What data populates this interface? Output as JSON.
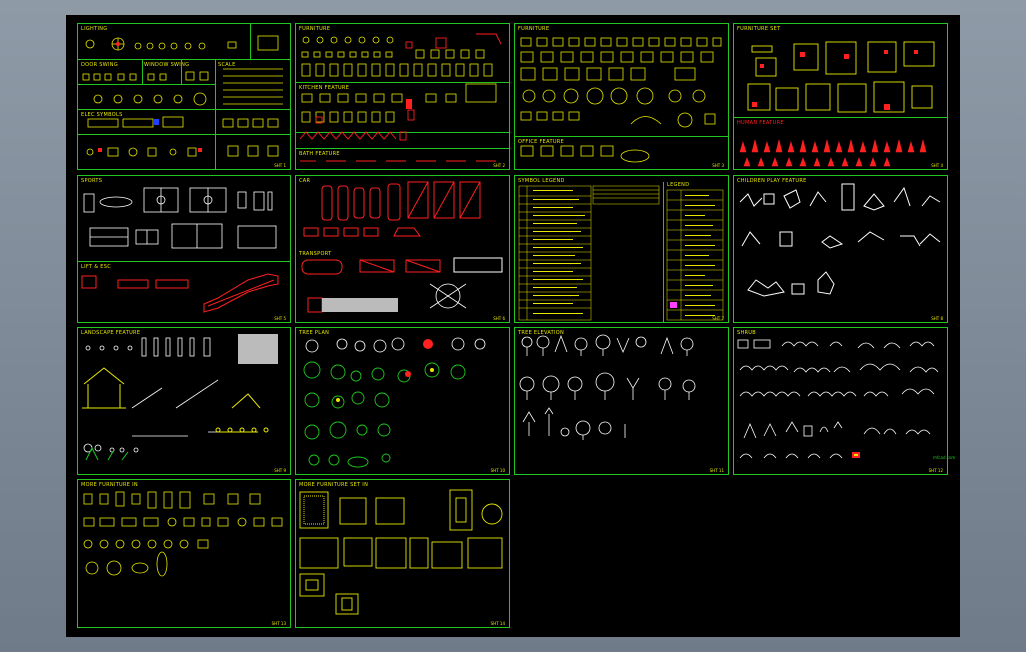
{
  "colors": {
    "accent": "#1fc71f",
    "symbol": "#e8e800",
    "highlight": "#ff2020",
    "frame_bg": "#000000",
    "desktop": "#7f8b99"
  },
  "panels": [
    {
      "id": "p1",
      "title": "LIGHTING",
      "sub": [
        "DOOR SWING",
        "WINDOW SWING",
        "ELEC SYMBOLS",
        "SCALE"
      ],
      "footer": "SHT 1"
    },
    {
      "id": "p2",
      "title": "FURNITURE",
      "sub": [
        "KITCHEN FEATURE",
        "BATH FEATURE"
      ],
      "footer": "SHT 2"
    },
    {
      "id": "p3",
      "title": "FURNITURE",
      "sub": [
        "OFFICE FEATURE"
      ],
      "footer": "SHT 3"
    },
    {
      "id": "p4",
      "title": "FURNITURE SET",
      "sub": [
        "HUMAN FEATURE"
      ],
      "footer": "SHT 4"
    },
    {
      "id": "p5",
      "title": "SPORTS",
      "sub": [
        "LIFT & ESC"
      ],
      "footer": "SHT 5"
    },
    {
      "id": "p6",
      "title": "CAR",
      "sub": [
        "TRANSPORT"
      ],
      "footer": "SHT 6"
    },
    {
      "id": "p7",
      "title": "SYMBOL LEGEND",
      "sub": [
        "LEGEND"
      ],
      "footer": "SHT 7"
    },
    {
      "id": "p8",
      "title": "CHILDREN PLAY FEATURE",
      "sub": [],
      "footer": "SHT 8"
    },
    {
      "id": "p9",
      "title": "LANDSCAPE FEATURE",
      "sub": [],
      "footer": "SHT 9"
    },
    {
      "id": "p10",
      "title": "TREE PLAN",
      "sub": [],
      "footer": "SHT 10"
    },
    {
      "id": "p11",
      "title": "TREE ELEVATION",
      "sub": [],
      "footer": "SHT 11"
    },
    {
      "id": "p12",
      "title": "SHRUB",
      "sub": [],
      "footer": "SHT 12"
    },
    {
      "id": "p13",
      "title": "MORE FURNITURE IN",
      "sub": [],
      "footer": "SHT 13"
    },
    {
      "id": "p14",
      "title": "MORE FURNITURE SET IN",
      "sub": [],
      "footer": "SHT 14"
    }
  ],
  "watermark": "mfcad.com"
}
